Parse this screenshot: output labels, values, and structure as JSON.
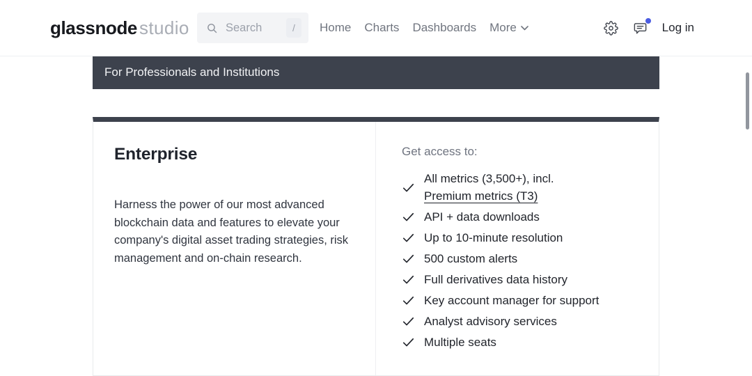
{
  "header": {
    "logo": {
      "primary": "glassnode",
      "secondary": "studio"
    },
    "search": {
      "placeholder": "Search",
      "shortcut": "/"
    },
    "nav": [
      {
        "label": "Home"
      },
      {
        "label": "Charts"
      },
      {
        "label": "Dashboards"
      },
      {
        "label": "More",
        "has_dropdown": true
      }
    ],
    "login_label": "Log in"
  },
  "banner": {
    "text": "For Professionals and Institutions"
  },
  "plan_card": {
    "title": "Enterprise",
    "description": "Harness the power of our most advanced blockchain data and features to elevate your company's digital asset trading strategies, risk management and on-chain research.",
    "features_heading": "Get access to:",
    "features": [
      {
        "text": "All metrics (3,500+), incl.",
        "link": "Premium metrics (T3)"
      },
      {
        "text": "API + data downloads"
      },
      {
        "text": "Up to 10-minute resolution"
      },
      {
        "text": "500 custom alerts"
      },
      {
        "text": "Full derivatives data history"
      },
      {
        "text": "Key account manager for support"
      },
      {
        "text": "Analyst advisory services"
      },
      {
        "text": "Multiple seats"
      }
    ]
  },
  "icons": {
    "search": "search-icon (magnifier)",
    "shortcut_badge": "slash key badge",
    "more": "chevron-down-icon",
    "settings": "gear-icon",
    "feedback": "chat-bubble-icon with notification dot",
    "feature": "checkmark-icon"
  },
  "colors": {
    "banner_bg": "#3d424d",
    "notification_dot": "#4b5ce1",
    "search_bg": "#f3f4f6",
    "nav_text": "#70757f",
    "feature_text": "#22252c"
  }
}
